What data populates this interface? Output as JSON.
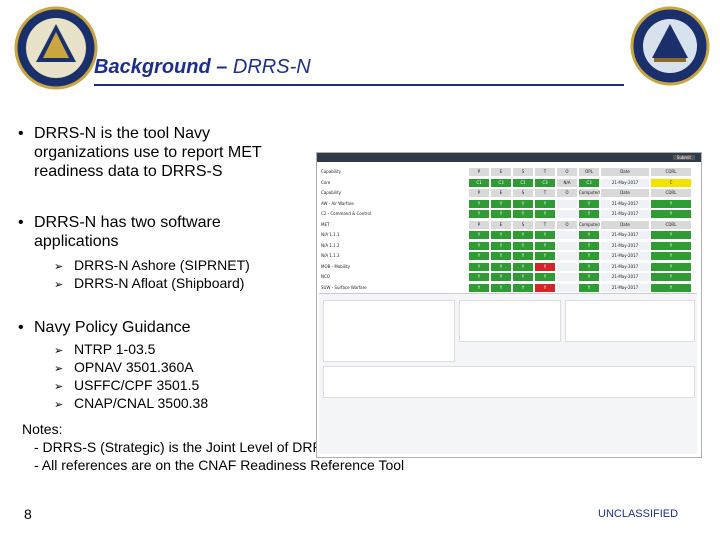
{
  "header": {
    "title_main": "Background – ",
    "title_sub": "DRRS-N"
  },
  "bullets": [
    {
      "dot": "•",
      "text": "DRRS-N is the tool Navy organizations use to report MET readiness data to DRRS-S"
    },
    {
      "dot": "•",
      "text": "DRRS-N has two software applications"
    },
    {
      "dot": "•",
      "text": "Navy Policy Guidance"
    }
  ],
  "sub_items": {
    "applications": [
      "DRRS-N Ashore (SIPRNET)",
      "DRRS-N Afloat (Shipboard)"
    ],
    "policy": [
      "NTRP 1-03.5",
      "OPNAV 3501.360A",
      "USFFC/CPF 3501.5",
      "CNAP/CNAL 3500.38"
    ],
    "arrow": "➢"
  },
  "notes": {
    "heading": "Notes:",
    "lines": [
      "- DRRS-S (Strategic) is the Joint Level of DRRS",
      "- All references are on the CNAF Readiness Reference Tool"
    ]
  },
  "page_number": "8",
  "footer": "UNCLASSIFIED",
  "colors": {
    "title": "#1c2f8f",
    "green": "#2e9b33",
    "red": "#d3262a",
    "yellow": "#f4e300"
  },
  "inset": {
    "submit": "Submit",
    "rows": [
      {
        "label": "Capability",
        "cells": [
          "P",
          "E",
          "S",
          "T",
          "O",
          "OPL",
          "Date",
          "CDRL"
        ],
        "cls": [
          "gray",
          "gray",
          "gray",
          "gray",
          "gray",
          "gray",
          "gray",
          "gray"
        ]
      },
      {
        "label": "Core",
        "cells": [
          "C1",
          "C3",
          "C1",
          "C3",
          "N/A",
          "C3",
          "21-May-2017",
          "C"
        ],
        "cls": [
          "g",
          "g",
          "g",
          "g",
          "gray",
          "g",
          "lite",
          "y"
        ]
      },
      {
        "label": "Capability",
        "cells": [
          "P",
          "E",
          "S",
          "T",
          "O",
          "Computed",
          "Date",
          "CDRL"
        ],
        "cls": [
          "gray",
          "gray",
          "gray",
          "gray",
          "gray",
          "gray",
          "gray",
          "gray"
        ]
      },
      {
        "label": "AW - Air Warfare",
        "cells": [
          "Y",
          "Y",
          "Y",
          "Y",
          "",
          "Y",
          "21-May-2017",
          "Y"
        ],
        "cls": [
          "g",
          "g",
          "g",
          "g",
          "lite",
          "g",
          "lite",
          "g"
        ]
      },
      {
        "label": "C2 - Command & Control",
        "cells": [
          "Y",
          "Y",
          "Y",
          "Y",
          "",
          "Y",
          "21-May-2017",
          "Y"
        ],
        "cls": [
          "g",
          "g",
          "g",
          "g",
          "lite",
          "g",
          "lite",
          "g"
        ]
      },
      {
        "label": "MET",
        "cells": [
          "P",
          "E",
          "S",
          "T",
          "O",
          "Computed",
          "Date",
          "CDRL"
        ],
        "cls": [
          "gray",
          "gray",
          "gray",
          "gray",
          "gray",
          "gray",
          "gray",
          "gray"
        ]
      },
      {
        "label": "N/A 1.1.1",
        "cells": [
          "Y",
          "Y",
          "Y",
          "Y",
          "",
          "Y",
          "21-May-2017",
          "Y"
        ],
        "cls": [
          "g",
          "g",
          "g",
          "g",
          "lite",
          "g",
          "lite",
          "g"
        ]
      },
      {
        "label": "N/A 1.1.2",
        "cells": [
          "Y",
          "Y",
          "Y",
          "Y",
          "",
          "Y",
          "21-May-2017",
          "Y"
        ],
        "cls": [
          "g",
          "g",
          "g",
          "g",
          "lite",
          "g",
          "lite",
          "g"
        ]
      },
      {
        "label": "N/A 1.1.3",
        "cells": [
          "Y",
          "Y",
          "Y",
          "Y",
          "",
          "Y",
          "21-May-2017",
          "Y"
        ],
        "cls": [
          "g",
          "g",
          "g",
          "g",
          "lite",
          "g",
          "lite",
          "g"
        ]
      },
      {
        "label": "MOB - Mobility",
        "cells": [
          "Y",
          "Y",
          "Y",
          "Y",
          "",
          "Y",
          "21-May-2017",
          "Y"
        ],
        "cls": [
          "g",
          "g",
          "g",
          "r",
          "lite",
          "g",
          "lite",
          "g"
        ]
      },
      {
        "label": "NCO",
        "cells": [
          "Y",
          "Y",
          "Y",
          "Y",
          "",
          "Y",
          "21-May-2017",
          "Y"
        ],
        "cls": [
          "g",
          "g",
          "g",
          "g",
          "lite",
          "g",
          "lite",
          "g"
        ]
      },
      {
        "label": "SUW - Surface Warfare",
        "cells": [
          "Y",
          "Y",
          "Y",
          "Y",
          "",
          "Y",
          "21-May-2017",
          "Y"
        ],
        "cls": [
          "g",
          "g",
          "g",
          "r",
          "lite",
          "g",
          "lite",
          "g"
        ]
      }
    ]
  }
}
